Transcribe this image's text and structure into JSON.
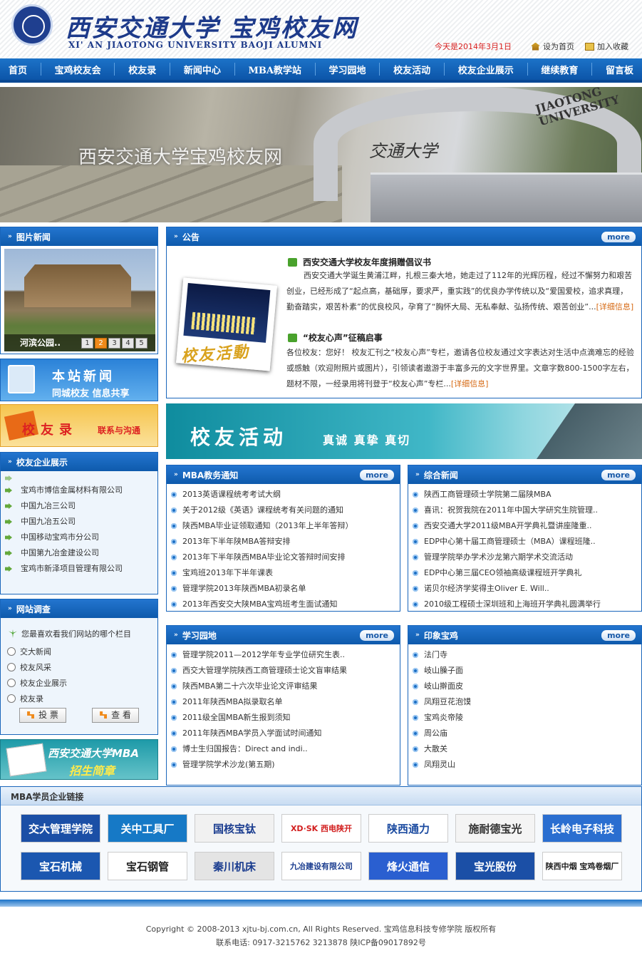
{
  "header": {
    "logo_cn": "西安交通大学 宝鸡校友网",
    "logo_en": "XI' AN JIAOTONG UNIVERSITY BAOJI ALUMNI",
    "date": "今天是2014年3月1日",
    "set_home": "设为首页",
    "bookmark": "加入收藏"
  },
  "nav": [
    "首页",
    "宝鸡校友会",
    "校友录",
    "新闻中心",
    "MBA教学站",
    "学习园地",
    "校友活动",
    "校友企业展示",
    "继续教育",
    "留言板"
  ],
  "banner": {
    "title": "西安交通大学宝鸡校友网",
    "uni": "JIAOTONG UNIVERSITY",
    "sign": "交通大学"
  },
  "pic_news": {
    "title": "图片新闻",
    "caption": "河滨公园..",
    "pages": [
      "1",
      "2",
      "3",
      "4",
      "5"
    ],
    "active_page": 2
  },
  "ad_news": {
    "line1": "本站新闻",
    "line2": "同城校友 信息共享"
  },
  "ad_alumni": {
    "line1": "校友录",
    "line2": "联系与沟通"
  },
  "enterprise": {
    "title": "校友企业展示",
    "items": [
      "宝鸡市博信金属材料有限公司",
      "中国九冶三公司",
      "中国九冶五公司",
      "中国移动宝鸡市分公司",
      "中国第九冶金建设公司",
      "宝鸡市新泽项目管理有限公司"
    ]
  },
  "survey": {
    "title": "网站调查",
    "question": "您最喜欢看我们网站的哪个栏目",
    "options": [
      "交大新闻",
      "校友风采",
      "校友企业展示",
      "校友录"
    ],
    "vote": "投 票",
    "view": "查 看"
  },
  "ad_mba": {
    "line1": "西安交通大学MBA",
    "line2": "招生简章"
  },
  "notice": {
    "title": "公告",
    "more": "more",
    "image_text": "校友活動",
    "items": [
      {
        "title": "西安交通大学校友年度捐赠倡议书",
        "body": "西安交通大学诞生黄浦江畔，扎根三秦大地，她走过了112年的光辉历程，经过不懈努力和艰苦创业，已经形成了“起点高，基础厚，要求严，重实践”的优良办学传统以及“爱国爱校，追求真理，勤奋踏实，艰苦朴素”的优良校风，孕育了“胸怀大局、无私奉献、弘扬传统、艰苦创业”...",
        "detail": "[详细信息]"
      },
      {
        "title": "“校友心声”征稿启事",
        "body": "各位校友：您好！ 校友汇刊之“校友心声”专栏，邀请各位校友通过文字表达对生活中点滴难忘的经验或感触（欢迎附照片或图片），引领读者遨游于丰富多元的文字世界里。文章字数800-1500字左右，题材不限，一经录用将刊登于“校友心声”专栏...",
        "detail": "[详细信息]"
      }
    ]
  },
  "activity_banner": {
    "title": "校友活动",
    "slogan": "真诚  真挚  真切"
  },
  "mba_box": {
    "title": "MBA教务通知",
    "more": "more",
    "items": [
      "2013英语课程统考考试大纲",
      "关于2012级《英语》课程统考有关问题的通知",
      "陕西MBA毕业证领取通知（2013年上半年答辩）",
      "2013年下半年陕MBA答辩安排",
      "2013年下半年陕西MBA毕业论文答辩时间安排",
      "宝鸡班2013年下半年课表",
      "管理学院2013年陕西MBA初录名单",
      "2013年西安交大陕MBA宝鸡班考生面试通知"
    ]
  },
  "gen_box": {
    "title": "综合新闻",
    "more": "more",
    "items": [
      "陕西工商管理硕士学院第二届陕MBA",
      "喜讯：祝贺我院在2011年中国大学研究生院管理..",
      "西安交通大学2011级MBA开学典礼暨讲座隆重..",
      "EDP中心第十届工商管理硕士（MBA）课程班隆..",
      "管理学院举办学术沙龙第六期学术交流活动",
      "EDP中心第三届CEO领袖高级课程班开学典礼",
      "诺贝尔经济学奖得主Oliver E. Will..",
      "2010级工程硕士深圳班和上海班开学典礼圆满举行"
    ]
  },
  "study_box": {
    "title": "学习园地",
    "more": "more",
    "items": [
      "管理学院2011—2012学年专业学位研究生表..",
      "西交大管理学院陕西工商管理硕士论文盲审结果",
      "陕西MBA第二十六次毕业论文评审结果",
      "2011年陕西MBA拟录取名单",
      "2011级全国MBA新生报到须知",
      "2011年陕西MBA学员入学面试时间通知",
      "博士生归国报告：Direct and indi..",
      "管理学院学术沙龙(第五期)"
    ]
  },
  "imp_box": {
    "title": "印象宝鸡",
    "more": "more",
    "items": [
      "法门寺",
      "岐山臊子面",
      "岐山擀面皮",
      "凤翔豆花泡馍",
      "宝鸡炎帝陵",
      "周公庙",
      "大散关",
      "凤翔灵山"
    ]
  },
  "links": {
    "title": "MBA学员企业链接",
    "row1": [
      {
        "text": "交大管理学院",
        "bg": "#1b4fa6",
        "fg": "#ffffff"
      },
      {
        "text": "关中工具厂",
        "bg": "#1679c6",
        "fg": "#ffffff"
      },
      {
        "text": "国核宝钛",
        "bg": "#f1f1f1",
        "fg": "#1a3c8f"
      },
      {
        "text": "XD·SK 西电陕开",
        "bg": "#ffffff",
        "fg": "#d21e1e"
      },
      {
        "text": "陕西通力",
        "bg": "#ffffff",
        "fg": "#1a4aa0"
      },
      {
        "text": "施耐德宝光",
        "bg": "#f4f4f4",
        "fg": "#333333"
      },
      {
        "text": "长岭电子科技",
        "bg": "#2a6ed0",
        "fg": "#ffffff"
      }
    ],
    "row2": [
      {
        "text": "宝石机械",
        "bg": "#1b57b0",
        "fg": "#ffffff"
      },
      {
        "text": "宝石钢管",
        "bg": "#ffffff",
        "fg": "#222222"
      },
      {
        "text": "秦川机床",
        "bg": "#e4e4e4",
        "fg": "#1a3c8f"
      },
      {
        "text": "九冶建设有限公司",
        "bg": "#ffffff",
        "fg": "#1a3c8f"
      },
      {
        "text": "烽火通信",
        "bg": "#2a5fd0",
        "fg": "#ffffff"
      },
      {
        "text": "宝光股份",
        "bg": "#1b4fa6",
        "fg": "#ffffff"
      },
      {
        "text": "陕西中烟 宝鸡卷烟厂",
        "bg": "#ffffff",
        "fg": "#222222"
      }
    ]
  },
  "footer": {
    "line1": "Copyright © 2008-2013 xjtu-bj.com.cn, All Rights Reserved. 宝鸡信息科技专修学院 版权所有",
    "line2": "联系电话: 0917-3215762 3213878 陕ICP备09017892号"
  }
}
